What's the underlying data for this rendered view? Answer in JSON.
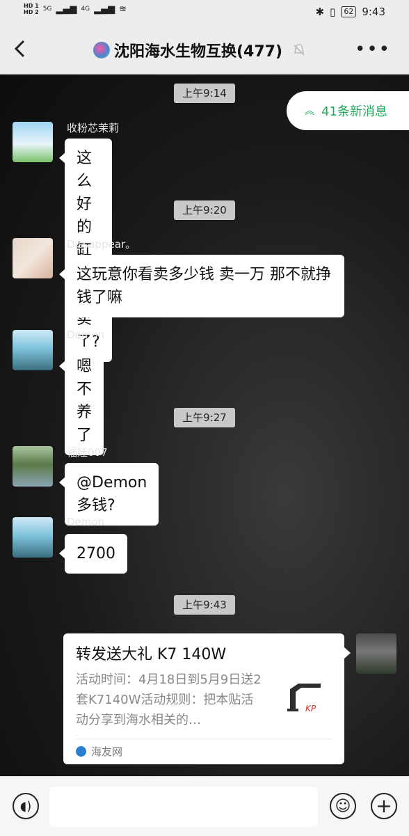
{
  "status_bar": {
    "hd1": "HD 1",
    "hd2": "HD 2",
    "net1": "5G",
    "net2": "4G",
    "battery": "62",
    "time": "9:43"
  },
  "header": {
    "back_icon": "chevron-left-icon",
    "title": "沈阳海水生物互换(477)",
    "mute_icon": "bell-off-icon",
    "more_icon": "more-dots-icon"
  },
  "new_messages": {
    "label": "41条新消息",
    "color": "#1faa5a"
  },
  "timestamps": [
    "上午9:14",
    "上午9:20",
    "上午9:27",
    "上午9:43"
  ],
  "messages": [
    {
      "sender": "收粉芯茉莉",
      "text": "这么好的缸就这卖了?"
    },
    {
      "sender": "Dissappear。",
      "text": "这玩意你看卖多少钱 卖一万 那不就挣钱了嘛"
    },
    {
      "sender": "Demon",
      "text": "嗯 不养了"
    },
    {
      "sender": "福娃007",
      "text": "@Demon  多钱?"
    },
    {
      "sender": "Demon",
      "text": "2700"
    }
  ],
  "link_card": {
    "title": "转发送大礼 K7 140W",
    "description": "活动时间：4月18日到5月9日送2套K7140W活动规则：把本贴活动分享到海水相关的…",
    "source": "海友网"
  },
  "input_bar": {
    "voice_icon": "voice-icon",
    "emoji_icon": "emoji-icon",
    "plus_icon": "plus-icon",
    "input_value": ""
  }
}
